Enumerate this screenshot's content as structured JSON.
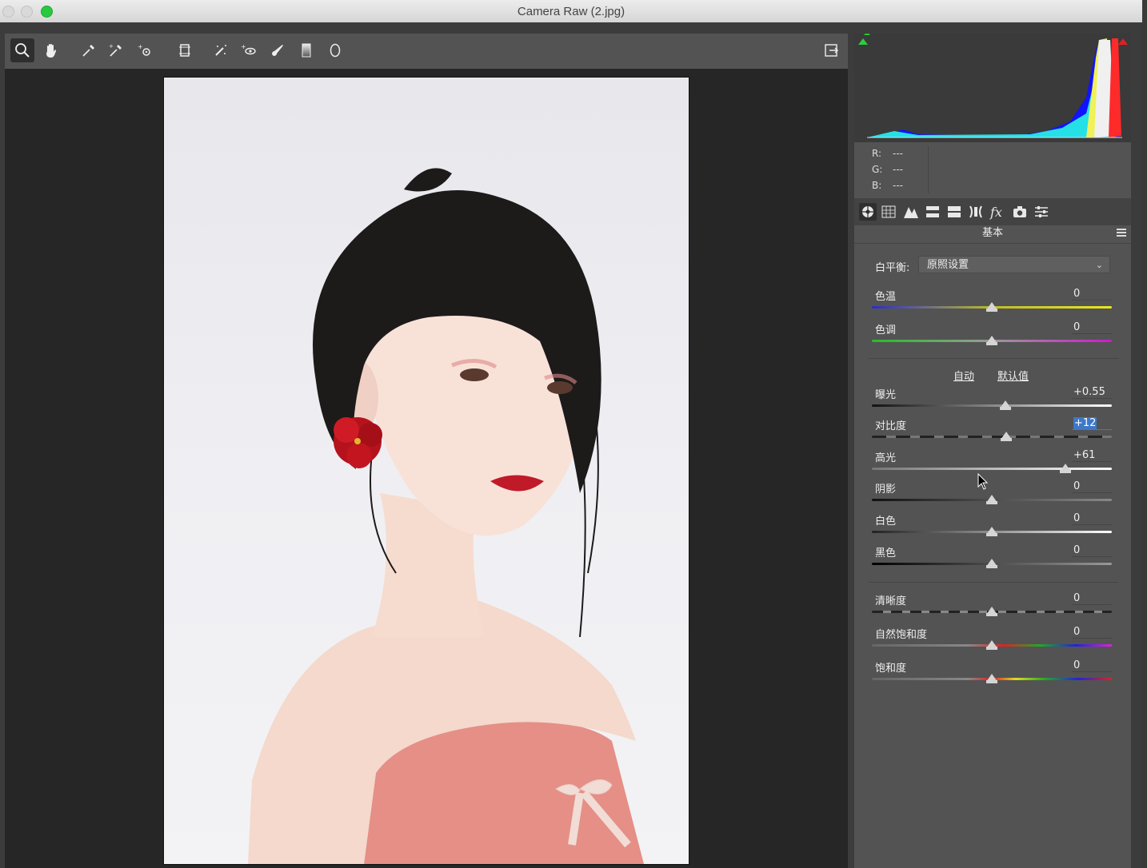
{
  "window": {
    "title": "Camera Raw (2.jpg)"
  },
  "toolbar": {
    "tools": [
      "zoom-icon",
      "hand-icon",
      "white-balance-icon",
      "color-sampler-icon",
      "targeted-adjust-icon",
      "transform-icon",
      "spot-removal-icon",
      "red-eye-icon",
      "adjustment-brush-icon",
      "graduated-filter-icon",
      "radial-filter-icon"
    ],
    "open_prefs": "preferences-icon"
  },
  "histogram": {
    "r": "---",
    "g": "---",
    "b": "---",
    "r_label": "R:",
    "g_label": "G:",
    "b_label": "B:"
  },
  "panel": {
    "tab_icons": [
      "basic-icon",
      "tone-curve-icon",
      "detail-icon",
      "hsl-icon",
      "split-toning-icon",
      "lens-icon",
      "effects-icon",
      "camera-calibration-icon",
      "presets-icon"
    ],
    "title": "基本",
    "white_balance": {
      "label": "白平衡:",
      "value": "原照设置"
    },
    "temp": {
      "label": "色温",
      "value": "0",
      "pos": 0.5
    },
    "tint": {
      "label": "色调",
      "value": "0",
      "pos": 0.5
    },
    "auto": "自动",
    "default": "默认值",
    "exposure": {
      "label": "曝光",
      "value": "+0.55",
      "pos": 0.555
    },
    "contrast": {
      "label": "对比度",
      "value": "+12",
      "pos": 0.56
    },
    "highlights": {
      "label": "高光",
      "value": "+61",
      "pos": 0.805
    },
    "shadows": {
      "label": "阴影",
      "value": "0",
      "pos": 0.5
    },
    "whites": {
      "label": "白色",
      "value": "0",
      "pos": 0.5
    },
    "blacks": {
      "label": "黑色",
      "value": "0",
      "pos": 0.5
    },
    "clarity": {
      "label": "清晰度",
      "value": "0",
      "pos": 0.5
    },
    "vibrance": {
      "label": "自然饱和度",
      "value": "0",
      "pos": 0.5
    },
    "saturation": {
      "label": "饱和度",
      "value": "0",
      "pos": 0.5
    }
  },
  "colors": {
    "panel": "#535353",
    "canvas": "#262626",
    "accent": "#3d78c9"
  }
}
